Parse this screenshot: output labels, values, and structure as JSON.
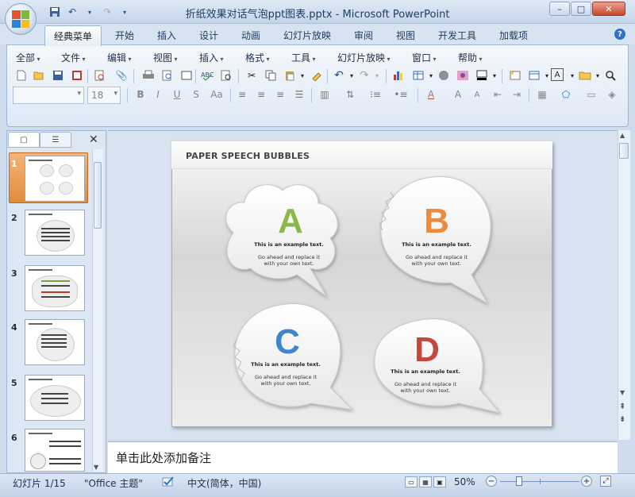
{
  "window": {
    "title": "折纸效果对话气泡ppt图表.pptx - Microsoft PowerPoint",
    "controls": [
      "–",
      "□",
      "✕"
    ]
  },
  "quick_access": [
    "save-icon",
    "undo-icon",
    "redo-icon",
    "customize-icon"
  ],
  "ribbon_tabs": [
    "经典菜单",
    "开始",
    "插入",
    "设计",
    "动画",
    "幻灯片放映",
    "审阅",
    "视图",
    "开发工具",
    "加载项"
  ],
  "menu": [
    "全部",
    "文件",
    "编辑",
    "视图",
    "插入",
    "格式",
    "工具",
    "幻灯片放映",
    "窗口",
    "帮助"
  ],
  "formatting": {
    "font_name": "",
    "font_size": "18"
  },
  "slide_panel": {
    "numbers": [
      "1",
      "2",
      "3",
      "4",
      "5",
      "6"
    ]
  },
  "slide": {
    "title": "PAPER SPEECH BUBBLES",
    "bubbles": [
      {
        "letter": "A",
        "color": "#8cb84a",
        "line1": "This is an example text.",
        "line2": "Go ahead and replace it",
        "line3": "with your own text."
      },
      {
        "letter": "B",
        "color": "#ef8a3a",
        "line1": "This is an example text.",
        "line2": "Go ahead and replace it",
        "line3": "with your own text."
      },
      {
        "letter": "C",
        "color": "#3f86cc",
        "line1": "This is an example text.",
        "line2": "Go ahead and replace it",
        "line3": "with your own text."
      },
      {
        "letter": "D",
        "color": "#c6473b",
        "line1": "This is an example text.",
        "line2": "Go ahead and replace it",
        "line3": "with your own text."
      }
    ]
  },
  "notes": {
    "placeholder": "单击此处添加备注"
  },
  "status_bar": {
    "slide_info": "幻灯片 1/15",
    "theme": "\"Office 主题\"",
    "language": "中文(简体，中国)",
    "zoom": "50%"
  }
}
